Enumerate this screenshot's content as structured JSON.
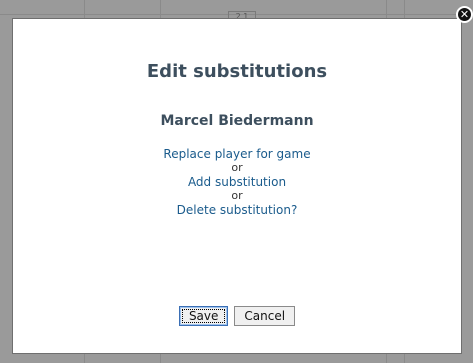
{
  "dialog": {
    "title": "Edit substitutions",
    "player_name": "Marcel Biedermann",
    "options": [
      {
        "label": "Replace player for game"
      },
      {
        "label": "Add substitution"
      },
      {
        "label": "Delete substitution?"
      }
    ],
    "separator": "or",
    "save_label": "Save",
    "cancel_label": "Cancel",
    "close_glyph": "✕"
  },
  "background": {
    "tab_label": "2 1"
  },
  "icons": {
    "close": "close-icon"
  },
  "colors": {
    "title": "#3d4f5e",
    "link": "#1a5b8c",
    "overlay": "#9a9a9a"
  }
}
